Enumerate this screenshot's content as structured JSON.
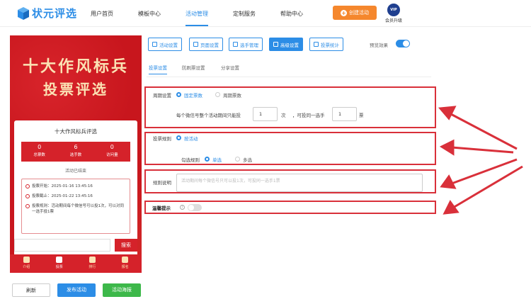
{
  "header": {
    "logo_text": "状元评选",
    "nav": [
      "用户首页",
      "模板中心",
      "活动管理",
      "定制服务",
      "帮助中心"
    ],
    "create_button": "创建活动",
    "vip_badge": "VIP",
    "vip_label": "会员升级"
  },
  "preview": {
    "banner_line1": "十大作风标兵",
    "banner_line2": "投票评选",
    "card_title": "十大作风标兵评选",
    "stats": [
      {
        "value": "0",
        "label": "总票数"
      },
      {
        "value": "6",
        "label": "选手数"
      },
      {
        "value": "0",
        "label": "访问量"
      }
    ],
    "status": "活动已结束",
    "info": [
      "投票开始：2025-01-16 13:45:16",
      "投票截止：2025-01-22 13:45:16",
      "投票规则：活动期间每个微信号可以投1次，可以对同一选手投1票"
    ],
    "search_button": "搜索",
    "tabs": [
      "介绍",
      "投票",
      "排行",
      "报名"
    ]
  },
  "bottom_buttons": {
    "refresh": "刷新",
    "publish": "发布活动",
    "poster": "活动海报"
  },
  "toolbar": {
    "buttons": [
      "活动设置",
      "页面设置",
      "选手管理",
      "高级设置",
      "投票统计"
    ],
    "active_index": 3,
    "preview_label": "预览效果",
    "preview_on": true
  },
  "subtabs": [
    "投票设置",
    "防刷票设置",
    "分享设置"
  ],
  "period": {
    "label": "周期设置",
    "option_fixed": "固定票数",
    "option_cycle": "周期票数",
    "sentence_a": "每个微信号整个活动期间只能投",
    "value_a": "1",
    "unit_a": "次",
    "sentence_b": "，可投同一选手",
    "value_b": "1",
    "unit_b": "票"
  },
  "rule": {
    "label": "投票规则",
    "option": "按活动",
    "check_label": "勾选规则",
    "single": "单选",
    "multi": "多选"
  },
  "desc": {
    "label": "规则说明",
    "placeholder": "活动期间每个微信号只可以投1次，可投同一选手1票"
  },
  "reminder": {
    "label": "温馨提示",
    "help": "?",
    "enabled": false
  },
  "colors": {
    "accent": "#2c8de6",
    "annotation_red": "#d9303a",
    "banner_red": "#c8161d",
    "create_orange": "#f5872d",
    "poster_green": "#3db84a"
  }
}
